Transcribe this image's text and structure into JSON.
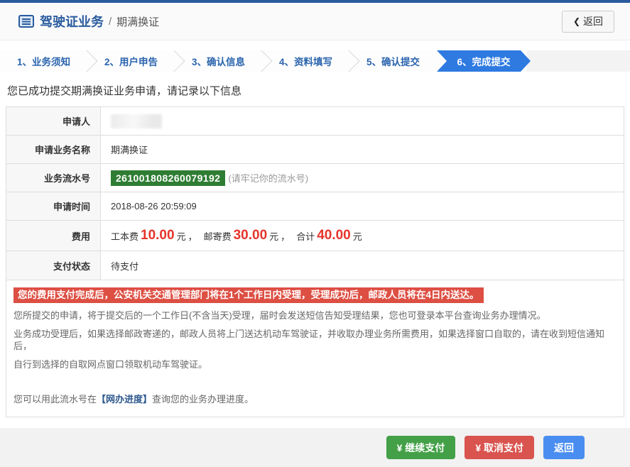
{
  "header": {
    "title": "驾驶证业务",
    "separator": "/",
    "subtitle": "期满换证",
    "back_chevron": "❮",
    "back_label": "返回"
  },
  "steps": [
    {
      "label": "1、业务须知",
      "active": false
    },
    {
      "label": "2、用户申告",
      "active": false
    },
    {
      "label": "3、确认信息",
      "active": false
    },
    {
      "label": "4、资料填写",
      "active": false
    },
    {
      "label": "5、确认提交",
      "active": false
    },
    {
      "label": "6、完成提交",
      "active": true
    }
  ],
  "main": {
    "success_message": "您已成功提交期满换证业务申请，请记录以下信息",
    "info_table": {
      "rows": [
        {
          "label": "申请人",
          "value": "",
          "redacted": true
        },
        {
          "label": "申请业务名称",
          "value": "期满换证"
        },
        {
          "label": "业务流水号",
          "serial": "261001808260079192",
          "note": "(请牢记你的流水号)"
        },
        {
          "label": "申请时间",
          "value": "2018-08-26 20:59:09"
        },
        {
          "label": "费用"
        },
        {
          "label": "支付状态",
          "value": "待支付"
        }
      ]
    },
    "fee": {
      "item1_label": "工本费",
      "item1_amount": "10.00",
      "item2_label": "邮寄费",
      "item2_amount": "30.00",
      "total_label": "合计",
      "total_amount": "40.00",
      "unit": "元",
      "separator": "，"
    },
    "warning": "您的费用支付完成后，公安机关交通管理部门将在1个工作日内受理，受理成功后，邮政人员将在4日内送达。",
    "notes": [
      "您所提交的申请，将于提交后的一个工作日(不含当天)受理，届时会发送短信告知受理结果，您也可登录本平台查询业务办理情况。",
      "业务成功受理后，如果选择邮政寄递的，邮政人员将上门送达机动车驾驶证，并收取办理业务所需费用，如果选择窗口自取的，请在收到短信通知后，",
      "自行到选择的自取网点窗口领取机动车驾驶证。"
    ],
    "progress_hint": {
      "prefix": "您可以用此流水号在",
      "link": "【网办进度】",
      "suffix": "查询您的业务办理进度。"
    }
  },
  "footer": {
    "buttons": [
      {
        "label": "¥ 继续支付",
        "color": "#43a047"
      },
      {
        "label": "¥ 取消支付",
        "color": "#d9534f"
      },
      {
        "label": "返回",
        "color": "#4a8df0"
      }
    ]
  },
  "colors": {
    "brand_blue": "#2a5b9e",
    "step_active_blue": "#2e7ae1",
    "serial_green": "#2e7d33",
    "fee_red": "#e5352b",
    "warning_red": "#dd4f43"
  }
}
